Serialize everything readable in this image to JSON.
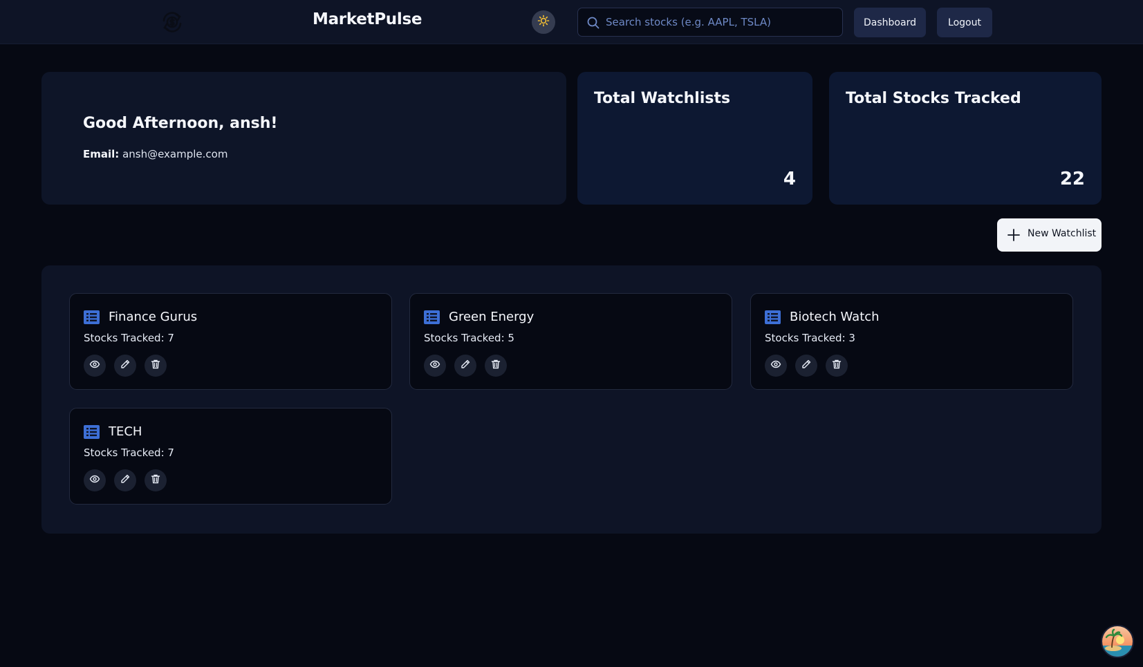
{
  "header": {
    "logo_icon": "currency-exchange-icon",
    "brand": "MarketPulse",
    "theme_icon": "sun-icon",
    "search_placeholder": "Search stocks (e.g. AAPL, TSLA)",
    "search_value": "",
    "dashboard_label": "Dashboard",
    "logout_label": "Logout"
  },
  "welcome": {
    "greeting": "Good Afternoon, ansh!",
    "email_label": "Email:",
    "email_value": "ansh@example.com"
  },
  "stats": {
    "watchlists_title": "Total Watchlists",
    "watchlists_value": "4",
    "stocks_title": "Total Stocks Tracked",
    "stocks_value": "22"
  },
  "actions": {
    "new_watchlist_label": "New Watchlist"
  },
  "watchlists": [
    {
      "name": "Finance Gurus",
      "count": "Stocks Tracked: 7"
    },
    {
      "name": "Green Energy",
      "count": "Stocks Tracked: 5"
    },
    {
      "name": "Biotech Watch",
      "count": "Stocks Tracked: 3"
    },
    {
      "name": "TECH",
      "count": "Stocks Tracked: 7"
    }
  ],
  "colors": {
    "background": "#060913",
    "accent": "#3d6fd6",
    "sun": "#f5c033"
  }
}
